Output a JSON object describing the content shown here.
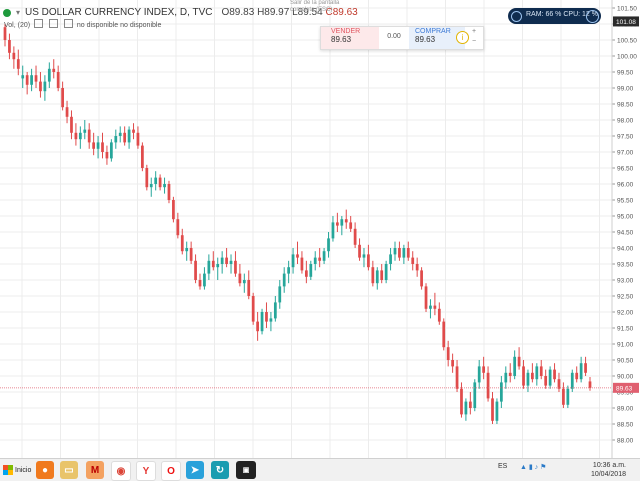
{
  "header": {
    "symbol_title": "US DOLLAR CURRENCY INDEX, D, TVC",
    "open": "O89.83",
    "high": "H89.97",
    "low": "L89.54",
    "close": "C89.63",
    "volume_label": "Vol, (20)",
    "volume_values": "no disponible  no disponible"
  },
  "fullscreen_tooltip": "Salir de la pantalla completa (ESC)",
  "trade_panel": {
    "sell_label": "VENDER",
    "sell_price": "89.63",
    "spread": "0.00",
    "buy_label": "COMPRAR",
    "buy_price": "89.63",
    "info_icon": "info-icon",
    "plus": "+",
    "minus": "−"
  },
  "system_monitor": {
    "text": "RAM: 66 %  CPU: 12 %"
  },
  "price_axis": {
    "top_price_label": "101.08",
    "current_price_label": "89.63",
    "current_price_color": "#e06070",
    "top_label_color": "#2b2b2b",
    "ticks": [
      "101.50",
      "101.00",
      "100.50",
      "100.00",
      "99.50",
      "99.00",
      "98.50",
      "98.00",
      "97.50",
      "97.00",
      "96.50",
      "96.00",
      "95.50",
      "95.00",
      "94.50",
      "94.00",
      "93.50",
      "93.00",
      "92.50",
      "92.00",
      "91.50",
      "91.00",
      "90.50",
      "90.00",
      "89.50",
      "89.00",
      "88.50",
      "88.00"
    ]
  },
  "colors": {
    "up": "#26a69a",
    "down": "#e04b4b",
    "grid": "#ececec",
    "price_line": "#e06070"
  },
  "chart_data": {
    "type": "candlestick",
    "y_range": [
      87.5,
      101.75
    ],
    "current_price": 89.63,
    "candles": [
      [
        100.9,
        101.0,
        100.3,
        100.5
      ],
      [
        100.5,
        100.7,
        99.9,
        100.1
      ],
      [
        100.1,
        100.3,
        99.6,
        99.9
      ],
      [
        99.9,
        100.2,
        99.4,
        99.6
      ],
      [
        99.3,
        99.7,
        99.0,
        99.4
      ],
      [
        99.4,
        99.5,
        98.8,
        99.1
      ],
      [
        99.1,
        99.6,
        98.9,
        99.4
      ],
      [
        99.4,
        99.7,
        99.0,
        99.2
      ],
      [
        99.2,
        99.5,
        98.7,
        98.9
      ],
      [
        98.9,
        99.4,
        98.6,
        99.2
      ],
      [
        99.2,
        99.8,
        99.0,
        99.6
      ],
      [
        99.6,
        99.9,
        99.3,
        99.5
      ],
      [
        99.5,
        99.7,
        98.9,
        99.0
      ],
      [
        99.0,
        99.2,
        98.3,
        98.4
      ],
      [
        98.4,
        98.6,
        97.9,
        98.1
      ],
      [
        98.1,
        98.3,
        97.4,
        97.6
      ],
      [
        97.6,
        97.9,
        97.2,
        97.4
      ],
      [
        97.4,
        97.8,
        97.1,
        97.6
      ],
      [
        97.6,
        98.0,
        97.4,
        97.7
      ],
      [
        97.7,
        97.9,
        97.1,
        97.3
      ],
      [
        97.3,
        97.6,
        96.9,
        97.1
      ],
      [
        97.1,
        97.5,
        96.8,
        97.3
      ],
      [
        97.3,
        97.6,
        96.8,
        97.0
      ],
      [
        97.0,
        97.2,
        96.6,
        96.8
      ],
      [
        96.8,
        97.4,
        96.7,
        97.3
      ],
      [
        97.3,
        97.7,
        97.1,
        97.5
      ],
      [
        97.5,
        97.8,
        97.3,
        97.6
      ],
      [
        97.6,
        97.8,
        97.2,
        97.3
      ],
      [
        97.3,
        97.8,
        97.1,
        97.7
      ],
      [
        97.7,
        97.9,
        97.4,
        97.6
      ],
      [
        97.6,
        97.8,
        97.1,
        97.2
      ],
      [
        97.2,
        97.3,
        96.4,
        96.5
      ],
      [
        96.5,
        96.6,
        95.8,
        95.9
      ],
      [
        95.9,
        96.2,
        95.6,
        96.0
      ],
      [
        96.0,
        96.4,
        95.8,
        96.2
      ],
      [
        96.2,
        96.3,
        95.8,
        95.9
      ],
      [
        95.9,
        96.2,
        95.7,
        96.0
      ],
      [
        96.0,
        96.1,
        95.4,
        95.5
      ],
      [
        95.5,
        95.6,
        94.8,
        94.9
      ],
      [
        94.9,
        95.1,
        94.3,
        94.4
      ],
      [
        94.4,
        94.6,
        93.8,
        93.9
      ],
      [
        93.9,
        94.2,
        93.6,
        94.0
      ],
      [
        94.0,
        94.2,
        93.5,
        93.6
      ],
      [
        93.6,
        93.8,
        92.9,
        93.0
      ],
      [
        93.0,
        93.2,
        92.7,
        92.8
      ],
      [
        92.8,
        93.4,
        92.7,
        93.2
      ],
      [
        93.2,
        93.8,
        93.0,
        93.6
      ],
      [
        93.6,
        93.9,
        93.3,
        93.4
      ],
      [
        93.4,
        93.7,
        93.0,
        93.5
      ],
      [
        93.5,
        93.9,
        93.2,
        93.7
      ],
      [
        93.7,
        94.0,
        93.4,
        93.5
      ],
      [
        93.5,
        93.8,
        93.2,
        93.6
      ],
      [
        93.6,
        93.9,
        93.1,
        93.2
      ],
      [
        93.2,
        93.5,
        92.8,
        92.9
      ],
      [
        92.9,
        93.2,
        92.6,
        93.0
      ],
      [
        93.0,
        93.3,
        92.4,
        92.5
      ],
      [
        92.5,
        92.6,
        91.6,
        91.7
      ],
      [
        91.7,
        92.0,
        91.1,
        91.4
      ],
      [
        91.4,
        92.1,
        91.3,
        92.0
      ],
      [
        92.0,
        92.3,
        91.5,
        91.7
      ],
      [
        91.7,
        92.0,
        91.4,
        91.8
      ],
      [
        91.8,
        92.5,
        91.7,
        92.3
      ],
      [
        92.3,
        93.0,
        92.1,
        92.8
      ],
      [
        92.8,
        93.4,
        92.6,
        93.2
      ],
      [
        93.2,
        93.6,
        92.9,
        93.4
      ],
      [
        93.4,
        94.0,
        93.2,
        93.8
      ],
      [
        93.8,
        94.2,
        93.5,
        93.7
      ],
      [
        93.7,
        93.9,
        93.2,
        93.3
      ],
      [
        93.3,
        93.6,
        92.9,
        93.1
      ],
      [
        93.1,
        93.6,
        93.0,
        93.5
      ],
      [
        93.5,
        93.9,
        93.3,
        93.7
      ],
      [
        93.7,
        94.0,
        93.4,
        93.6
      ],
      [
        93.6,
        94.0,
        93.5,
        93.9
      ],
      [
        93.9,
        94.5,
        93.7,
        94.3
      ],
      [
        94.3,
        95.0,
        94.2,
        94.8
      ],
      [
        94.8,
        95.1,
        94.5,
        94.7
      ],
      [
        94.7,
        95.0,
        94.4,
        94.9
      ],
      [
        94.9,
        95.2,
        94.6,
        94.8
      ],
      [
        94.8,
        95.0,
        94.5,
        94.6
      ],
      [
        94.6,
        94.8,
        94.0,
        94.1
      ],
      [
        94.1,
        94.3,
        93.6,
        93.7
      ],
      [
        93.7,
        94.0,
        93.4,
        93.8
      ],
      [
        93.8,
        94.1,
        93.3,
        93.4
      ],
      [
        93.4,
        93.6,
        92.8,
        92.9
      ],
      [
        92.9,
        93.4,
        92.7,
        93.3
      ],
      [
        93.3,
        93.5,
        92.9,
        93.0
      ],
      [
        93.0,
        93.6,
        92.9,
        93.5
      ],
      [
        93.5,
        94.0,
        93.3,
        93.8
      ],
      [
        93.8,
        94.2,
        93.6,
        94.0
      ],
      [
        94.0,
        94.2,
        93.6,
        93.7
      ],
      [
        93.7,
        94.1,
        93.5,
        94.0
      ],
      [
        94.0,
        94.2,
        93.6,
        93.7
      ],
      [
        93.7,
        93.9,
        93.3,
        93.5
      ],
      [
        93.5,
        93.7,
        93.1,
        93.3
      ],
      [
        93.3,
        93.4,
        92.7,
        92.8
      ],
      [
        92.8,
        92.9,
        92.0,
        92.1
      ],
      [
        92.1,
        92.4,
        91.8,
        92.2
      ],
      [
        92.2,
        92.6,
        91.9,
        92.1
      ],
      [
        92.1,
        92.3,
        91.6,
        91.7
      ],
      [
        91.7,
        91.8,
        90.8,
        90.9
      ],
      [
        90.9,
        91.1,
        90.3,
        90.5
      ],
      [
        90.5,
        90.7,
        90.1,
        90.3
      ],
      [
        90.3,
        90.5,
        89.5,
        89.6
      ],
      [
        89.6,
        89.8,
        88.7,
        88.8
      ],
      [
        88.8,
        89.3,
        88.6,
        89.2
      ],
      [
        89.2,
        89.5,
        88.8,
        89.0
      ],
      [
        89.0,
        89.9,
        88.9,
        89.8
      ],
      [
        89.8,
        90.5,
        89.6,
        90.3
      ],
      [
        90.3,
        90.6,
        89.9,
        90.1
      ],
      [
        90.1,
        90.3,
        89.2,
        89.3
      ],
      [
        89.3,
        89.5,
        88.5,
        88.6
      ],
      [
        88.6,
        89.3,
        88.5,
        89.2
      ],
      [
        89.2,
        90.0,
        89.0,
        89.8
      ],
      [
        89.8,
        90.3,
        89.6,
        90.1
      ],
      [
        90.1,
        90.4,
        89.8,
        90.0
      ],
      [
        90.0,
        90.8,
        89.9,
        90.6
      ],
      [
        90.6,
        90.9,
        90.2,
        90.3
      ],
      [
        90.3,
        90.5,
        89.6,
        89.7
      ],
      [
        89.7,
        90.2,
        89.5,
        90.1
      ],
      [
        90.1,
        90.4,
        89.8,
        89.9
      ],
      [
        89.9,
        90.4,
        89.7,
        90.3
      ],
      [
        90.3,
        90.5,
        89.9,
        90.0
      ],
      [
        90.0,
        90.2,
        89.6,
        89.7
      ],
      [
        89.7,
        90.3,
        89.6,
        90.2
      ],
      [
        90.2,
        90.4,
        89.8,
        89.9
      ],
      [
        89.9,
        90.1,
        89.5,
        89.6
      ],
      [
        89.6,
        89.8,
        89.0,
        89.1
      ],
      [
        89.1,
        89.7,
        89.0,
        89.6
      ],
      [
        89.6,
        90.2,
        89.5,
        90.1
      ],
      [
        90.1,
        90.3,
        89.8,
        89.9
      ],
      [
        89.9,
        90.6,
        89.8,
        90.4
      ],
      [
        90.4,
        90.6,
        90.0,
        90.1
      ],
      [
        89.83,
        89.97,
        89.54,
        89.63
      ]
    ]
  },
  "taskbar": {
    "start_label": "Inicio",
    "language": "ES",
    "time": "10:36 a.m.",
    "date": "10/04/2018",
    "icons": [
      "firefox-icon",
      "folder-icon",
      "mega-icon",
      "chrome-icon",
      "yandex-icon",
      "opera-icon",
      "telegram-icon",
      "refresh-app-icon",
      "app-dark-icon"
    ]
  }
}
